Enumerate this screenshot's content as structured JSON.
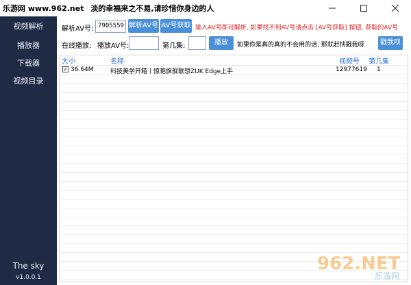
{
  "window": {
    "site_label": "乐游网 www.962.net",
    "title": "淡的幸福来之不易,请珍惜你身边的人"
  },
  "sidebar": {
    "items": [
      {
        "label": "视频解析"
      },
      {
        "label": "播放器"
      },
      {
        "label": "下载器"
      },
      {
        "label": "视频目录"
      }
    ],
    "footer_name": "The sky",
    "footer_version": "v1.0.0.1"
  },
  "parse": {
    "label": "解析AV号:",
    "input_value": "7905559",
    "parse_button": "解析AV号",
    "fetch_button": "AV号获取",
    "hint": "输入AV号即可解析, 如果找不到AV号请点击 [AV号获取] 按钮, 获取的AV号"
  },
  "play": {
    "label": "在线播放:",
    "av_label": "播放AV号:",
    "av_value": "",
    "ep_label": "第几集:",
    "ep_value": "",
    "play_button": "播放",
    "note": "如果你是真的真的不会用的话, 那就赶快戳我呀",
    "poke_button": "戳我呗"
  },
  "table": {
    "headers": {
      "size": "大小",
      "name": "名称",
      "vid": "视频号",
      "ep": "第几集"
    },
    "rows": [
      {
        "checked": true,
        "size": "36.64M",
        "name": "科技美学开箱丨惊艳旗舰联想ZUK Edge上手",
        "vid": "12977619",
        "ep": "1"
      }
    ]
  },
  "watermark": {
    "brand": "962.NET",
    "sub": "乐游网"
  },
  "colors": {
    "sidebar_bg": "#1f2a44",
    "button_bg": "#4a90d9",
    "hint_red": "#e02020",
    "header_blue": "#2a6fd6"
  }
}
